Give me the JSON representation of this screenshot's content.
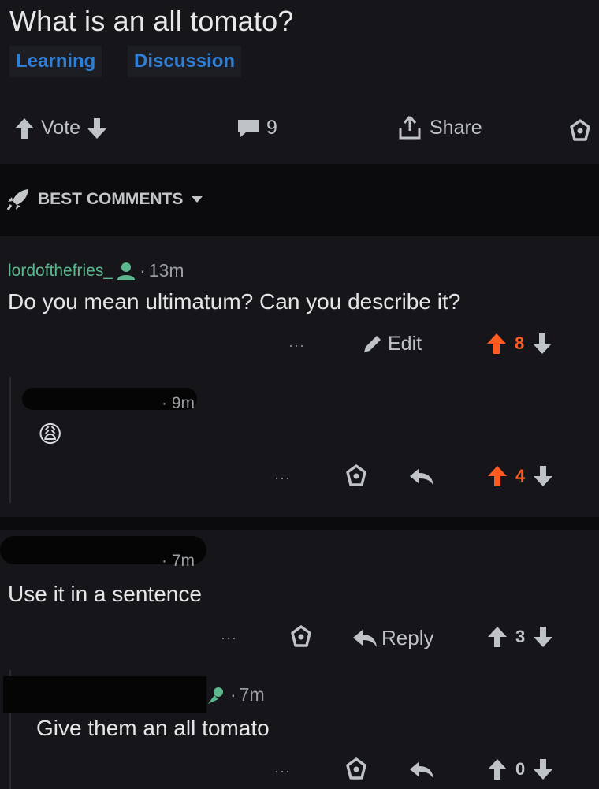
{
  "post": {
    "title": "What is an all tomato?",
    "flairs": [
      "Learning",
      "Discussion"
    ],
    "vote_label": "Vote",
    "comment_count": "9",
    "share_label": "Share"
  },
  "sort": {
    "label": "BEST COMMENTS"
  },
  "comments": [
    {
      "username": "lordofthefries_",
      "time": "13m",
      "text": "Do you mean ultimatum? Can you describe it?",
      "more": "···",
      "edit_label": "Edit",
      "score": "8",
      "upvoted": true
    },
    {
      "time": "9m",
      "emoji": "😩",
      "more": "···",
      "score": "4",
      "upvoted": true
    },
    {
      "time": "7m",
      "text": "Use it in a sentence",
      "more": "···",
      "reply_label": "Reply",
      "score": "3",
      "upvoted": false
    },
    {
      "time": "7m",
      "text": "Give them an all tomato",
      "more": "···",
      "score": "0",
      "upvoted": false
    }
  ],
  "colors": {
    "background": "#16161a",
    "band": "#0b0b0d",
    "flair_text": "#2f7fd6",
    "username": "#5cb88f",
    "upvote_active": "#ff5a1f"
  }
}
